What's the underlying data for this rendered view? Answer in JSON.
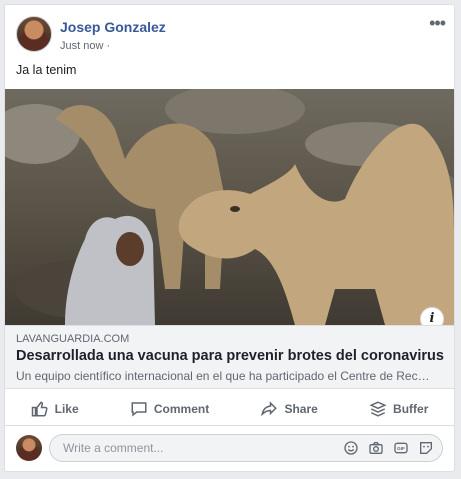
{
  "post": {
    "author": "Josep Gonzalez",
    "time": "Just now",
    "separator": "·",
    "text": "Ja la tenim",
    "more_icon": "•••"
  },
  "link": {
    "domain": "LAVANGUARDIA.COM",
    "headline": "Desarrollada una vacuna para prevenir brotes del coronavirus",
    "description": "Un equipo científico internacional en el que ha participado el Centre de Recerca…",
    "info_icon": "i"
  },
  "actions": {
    "like": "Like",
    "comment": "Comment",
    "share": "Share",
    "buffer": "Buffer"
  },
  "composer": {
    "placeholder": "Write a comment..."
  },
  "icons": [
    "ellipsis-icon",
    "info-icon",
    "like-icon",
    "comment-icon",
    "share-icon",
    "buffer-icon",
    "emoji-icon",
    "camera-icon",
    "gif-icon",
    "sticker-icon"
  ]
}
